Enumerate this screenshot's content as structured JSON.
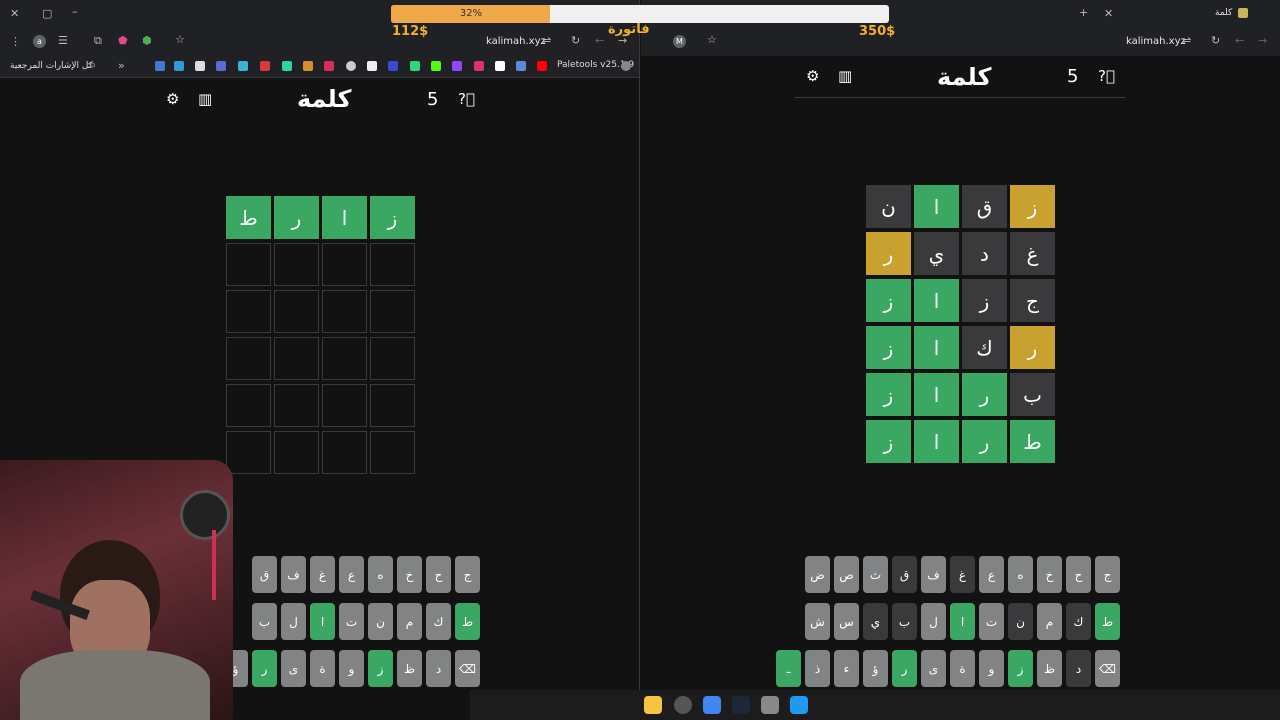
{
  "stream": {
    "progress_text": "32%",
    "progress_value": 32,
    "money_left": "112$",
    "money_right": "350$",
    "invoice": "فاتورة"
  },
  "left_browser": {
    "url": "kalimah.xyz",
    "bookmarks_label": "كل الإشارات المرجعية",
    "paletools": "Paletools v25.1.9",
    "profile_letter": "a"
  },
  "right_browser": {
    "url": "kalimah.xyz",
    "tab_title": "كلمة",
    "profile_letter": "M"
  },
  "left_game": {
    "title": "كلمة",
    "streak": "5",
    "rows": [
      [
        {
          "l": "ز",
          "s": "green"
        },
        {
          "l": "ا",
          "s": "green"
        },
        {
          "l": "ر",
          "s": "green"
        },
        {
          "l": "ط",
          "s": "green"
        }
      ],
      [
        {
          "l": "",
          "s": "empty"
        },
        {
          "l": "",
          "s": "empty"
        },
        {
          "l": "",
          "s": "empty"
        },
        {
          "l": "",
          "s": "empty"
        }
      ],
      [
        {
          "l": "",
          "s": "empty"
        },
        {
          "l": "",
          "s": "empty"
        },
        {
          "l": "",
          "s": "empty"
        },
        {
          "l": "",
          "s": "empty"
        }
      ],
      [
        {
          "l": "",
          "s": "empty"
        },
        {
          "l": "",
          "s": "empty"
        },
        {
          "l": "",
          "s": "empty"
        },
        {
          "l": "",
          "s": "empty"
        }
      ],
      [
        {
          "l": "",
          "s": "empty"
        },
        {
          "l": "",
          "s": "empty"
        },
        {
          "l": "",
          "s": "empty"
        },
        {
          "l": "",
          "s": "empty"
        }
      ],
      [
        {
          "l": "",
          "s": "empty"
        },
        {
          "l": "",
          "s": "empty"
        },
        {
          "l": "",
          "s": "empty"
        },
        {
          "l": "",
          "s": "empty"
        }
      ]
    ],
    "keyboard": [
      [
        {
          "l": "ج"
        },
        {
          "l": "ح"
        },
        {
          "l": "خ"
        },
        {
          "l": "ه"
        },
        {
          "l": "ع"
        },
        {
          "l": "غ"
        },
        {
          "l": "ف"
        },
        {
          "l": "ق"
        }
      ],
      [
        {
          "l": "ط",
          "s": "green"
        },
        {
          "l": "ك"
        },
        {
          "l": "م"
        },
        {
          "l": "ن"
        },
        {
          "l": "ت"
        },
        {
          "l": "ا",
          "s": "green"
        },
        {
          "l": "ل"
        },
        {
          "l": "ب"
        }
      ],
      [
        {
          "l": "⌫"
        },
        {
          "l": "د"
        },
        {
          "l": "ظ"
        },
        {
          "l": "ز",
          "s": "green"
        },
        {
          "l": "و"
        },
        {
          "l": "ة"
        },
        {
          "l": "ى"
        },
        {
          "l": "ر",
          "s": "green"
        },
        {
          "l": "ؤ"
        }
      ]
    ]
  },
  "right_game": {
    "title": "كلمة",
    "streak": "5",
    "rows": [
      [
        {
          "l": "ز",
          "s": "yellow"
        },
        {
          "l": "ق",
          "s": "gray"
        },
        {
          "l": "ا",
          "s": "green"
        },
        {
          "l": "ن",
          "s": "gray"
        }
      ],
      [
        {
          "l": "غ",
          "s": "gray"
        },
        {
          "l": "د",
          "s": "gray"
        },
        {
          "l": "ي",
          "s": "gray"
        },
        {
          "l": "ر",
          "s": "yellow"
        }
      ],
      [
        {
          "l": "ج",
          "s": "gray"
        },
        {
          "l": "ز",
          "s": "gray"
        },
        {
          "l": "ا",
          "s": "green"
        },
        {
          "l": "ز",
          "s": "green"
        }
      ],
      [
        {
          "l": "ر",
          "s": "yellow"
        },
        {
          "l": "ك",
          "s": "gray"
        },
        {
          "l": "ا",
          "s": "green"
        },
        {
          "l": "ز",
          "s": "green"
        }
      ],
      [
        {
          "l": "ب",
          "s": "gray"
        },
        {
          "l": "ر",
          "s": "green"
        },
        {
          "l": "ا",
          "s": "green"
        },
        {
          "l": "ز",
          "s": "green"
        }
      ],
      [
        {
          "l": "ط",
          "s": "green"
        },
        {
          "l": "ر",
          "s": "green"
        },
        {
          "l": "ا",
          "s": "green"
        },
        {
          "l": "ز",
          "s": "green"
        }
      ]
    ],
    "keyboard": [
      [
        {
          "l": "ج"
        },
        {
          "l": "ح"
        },
        {
          "l": "خ"
        },
        {
          "l": "ه"
        },
        {
          "l": "ع"
        },
        {
          "l": "غ",
          "s": "dark"
        },
        {
          "l": "ف"
        },
        {
          "l": "ق",
          "s": "dark"
        },
        {
          "l": "ث"
        },
        {
          "l": "ص"
        },
        {
          "l": "ض"
        }
      ],
      [
        {
          "l": "ط",
          "s": "green"
        },
        {
          "l": "ك",
          "s": "dark"
        },
        {
          "l": "م"
        },
        {
          "l": "ن",
          "s": "dark"
        },
        {
          "l": "ت"
        },
        {
          "l": "ا",
          "s": "green"
        },
        {
          "l": "ل"
        },
        {
          "l": "ب",
          "s": "dark"
        },
        {
          "l": "ي",
          "s": "dark"
        },
        {
          "l": "س"
        },
        {
          "l": "ش"
        }
      ],
      [
        {
          "l": "⌫"
        },
        {
          "l": "د",
          "s": "dark"
        },
        {
          "l": "ظ"
        },
        {
          "l": "ز",
          "s": "green"
        },
        {
          "l": "و"
        },
        {
          "l": "ة"
        },
        {
          "l": "ى"
        },
        {
          "l": "ر",
          "s": "green"
        },
        {
          "l": "ؤ"
        },
        {
          "l": "ء"
        },
        {
          "l": "ذ"
        },
        {
          "l": "ـ",
          "s": "green"
        }
      ]
    ]
  }
}
